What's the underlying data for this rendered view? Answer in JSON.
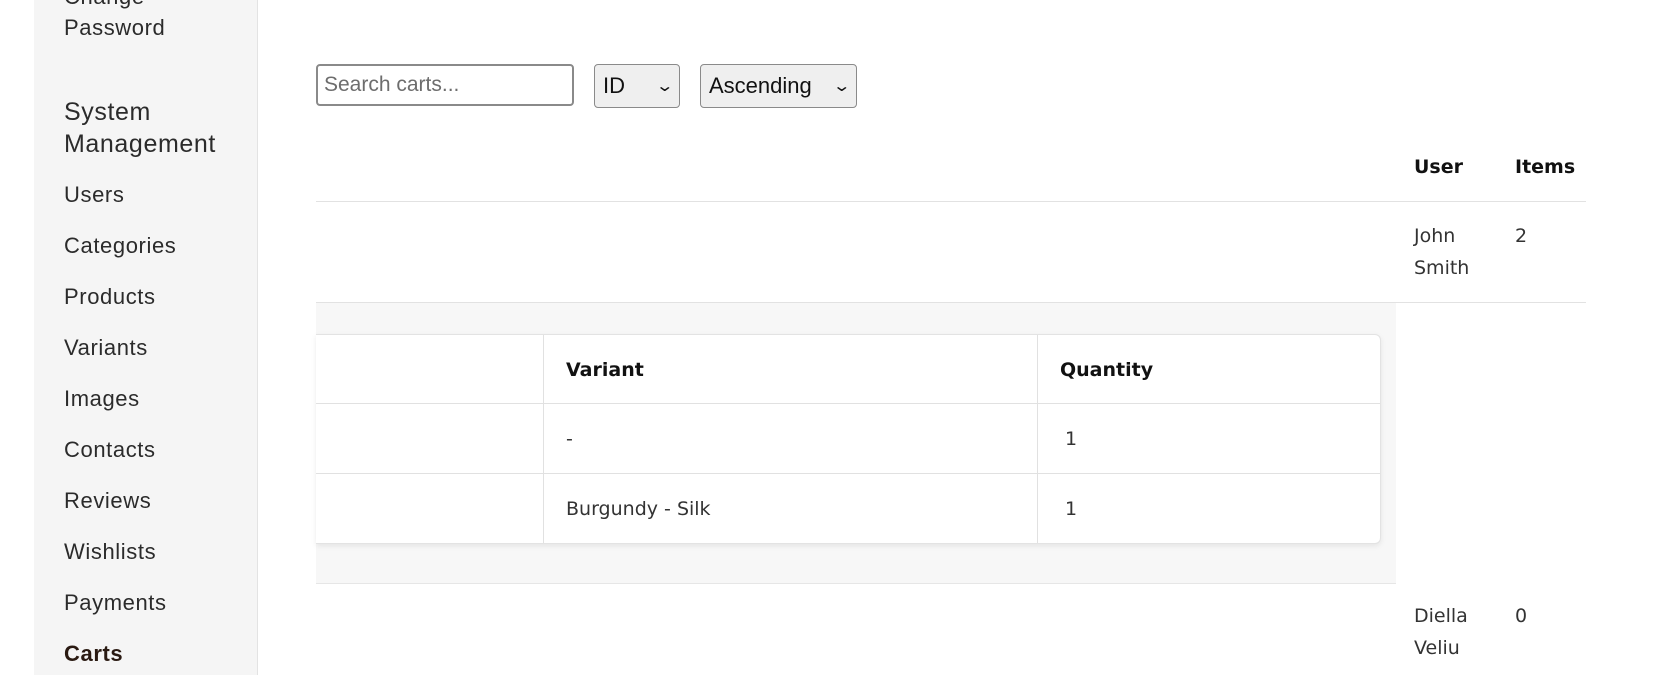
{
  "sidebar": {
    "partial_top_label": "Change",
    "password_label": "Password",
    "section_heading": "System Management",
    "items": [
      {
        "label": "Users"
      },
      {
        "label": "Categories"
      },
      {
        "label": "Products"
      },
      {
        "label": "Variants"
      },
      {
        "label": "Images"
      },
      {
        "label": "Contacts"
      },
      {
        "label": "Reviews"
      },
      {
        "label": "Wishlists"
      },
      {
        "label": "Payments"
      },
      {
        "label": "Carts",
        "active": true
      }
    ]
  },
  "toolbar": {
    "search_placeholder": "Search carts...",
    "sort_field": "ID",
    "sort_order": "Ascending"
  },
  "carts_table": {
    "columns": [
      "User",
      "Items"
    ],
    "rows": [
      {
        "user": "John Smith",
        "user_line1": "John",
        "user_line2": "Smith",
        "items": "2"
      },
      {
        "user": "Diella Veliu",
        "user_line1": "Diella",
        "user_line2": "Veliu",
        "items": "0"
      }
    ]
  },
  "cart_items": {
    "columns": [
      "Variant",
      "Quantity"
    ],
    "rows": [
      {
        "variant": "-",
        "quantity": "1"
      },
      {
        "variant": "Burgundy - Silk",
        "quantity": "1"
      }
    ]
  },
  "colors": {
    "sidebar_bg": "#f5f5f5",
    "active_link": "#2a1a12",
    "expanded_bg": "#f7f7f7"
  },
  "icons": {
    "select_chevron": "chevron-down-icon"
  }
}
